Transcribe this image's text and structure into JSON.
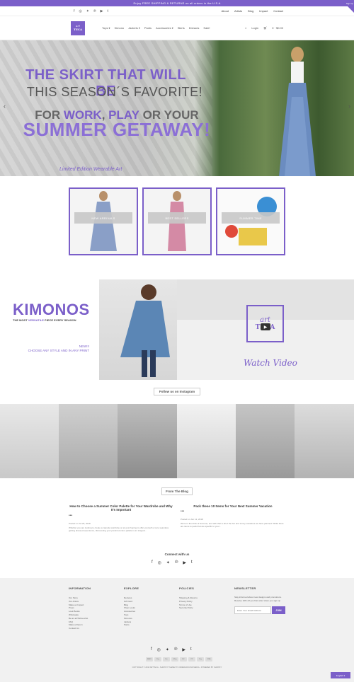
{
  "announcement": "Enjoy FREE SHIPPING & RETURNS on all orders in the U.S.A",
  "corner_badge": "Sign up",
  "top_links": [
    "About",
    "Artists",
    "Blog",
    "Impact",
    "Contact"
  ],
  "social_icons": [
    "facebook-icon",
    "instagram-icon",
    "twitter-icon",
    "pinterest-icon",
    "youtube-icon",
    "tumblr-icon"
  ],
  "nav": {
    "logo_top": "art",
    "logo_bottom": "TECA",
    "menu": [
      "Tops ▾",
      "Kimono",
      "Jackets ▾",
      "Pants",
      "Accessories ▾",
      "Skirts",
      "Dresses",
      "Sale!"
    ],
    "search_label": "",
    "login": "Login",
    "cart": "0 · $0.00"
  },
  "hero": {
    "line1": "THE SKIRT THAT WILL BE",
    "line2": "THIS SEASON´S FAVORITE!",
    "line3_a": "FOR ",
    "line3_b": "WORK",
    "line3_c": ", ",
    "line3_d": "PLAY",
    "line3_e": " OR YOUR",
    "line4": "SUMMER GETAWAY!",
    "tagline": "Limited Edition Wearable Art",
    "prev": "‹",
    "next": "›"
  },
  "collections": [
    {
      "label": "NEW ARRIVALS"
    },
    {
      "label": "BEST SELLERS"
    },
    {
      "label": "SUMMER TIME"
    }
  ],
  "kimonos": {
    "title": "KIMONOS",
    "sub_a": "THE MOST ",
    "sub_b": "VERSATILE",
    "sub_c": " PIECE EVERY SEASON",
    "new_line1": "NEW!!!",
    "new_line2": "CHOOSE ANY STYLE AND IN ANY PRINT",
    "logo_top": "art",
    "logo_bottom": "TECA",
    "watch": "Watch Video"
  },
  "instagram": {
    "button": "Follow us on Instagram"
  },
  "blog": {
    "button": "From The Blog",
    "posts": [
      {
        "title": "How to Choose a Summer Color Palette for Your Wardrobe and Why It's Important",
        "dots": "•••",
        "date": "Posted on Jul 20, 2018",
        "excerpt": "Whether you are looking to create a capsule wardrobe or are just hoping to offer yourself a more seamless getting dressed experience, discovering your preferred color palette is an integral..."
      },
      {
        "title": "Pack these 10 Items for Your Next Summer Vacation",
        "dots": "•••",
        "date": "Posted on Jun 12, 2018",
        "excerpt": "We're in the thick of Summer, and with that is all of the fun and sunny vacations we have planned. While there are items to pack that are specific to your..."
      }
    ]
  },
  "connect": "Connect with us",
  "footer": {
    "information": {
      "title": "INFORMATION",
      "items": [
        "Our Story",
        "Our Artists",
        "Make an Impact",
        "Press",
        "Look Books",
        "Wholesale",
        "Be an artTECa artist",
        "FAQ",
        "Make a Return",
        "Contact Us"
      ]
    },
    "explore": {
      "title": "EXPLORE",
      "items": [
        "Reviews",
        "Gift Card",
        "Blog",
        "Shop Looks",
        "Accessories",
        "Tops",
        "Kimonos",
        "Jackets",
        "Pants"
      ]
    },
    "policies": {
      "title": "POLICIES",
      "items": [
        "Shipping & Returns",
        "Privacy Policy",
        "Terms of Use",
        "Security Policy"
      ]
    },
    "newsletter": {
      "title": "NEWSLETTER",
      "text": "Stay informed about new designs and promotions. Receive 10% off you first order when you sign up",
      "placeholder": "Enter Your Email Address",
      "button": "JOIN"
    },
    "payments": [
      "AMEX",
      "Pay",
      "Dsc",
      "GPay",
      "MC",
      "PP",
      "Pay",
      "VISA"
    ],
    "copyright": "COPYRIGHT © 2018 ARTTECA - SHOPIFY THEME BY UNDERGROUND MEDIA - POWERED BY SHOPIFY",
    "language": "English ▾"
  },
  "colors": {
    "accent": "#7b5fc9",
    "footer_bg": "#f1f1f1"
  }
}
